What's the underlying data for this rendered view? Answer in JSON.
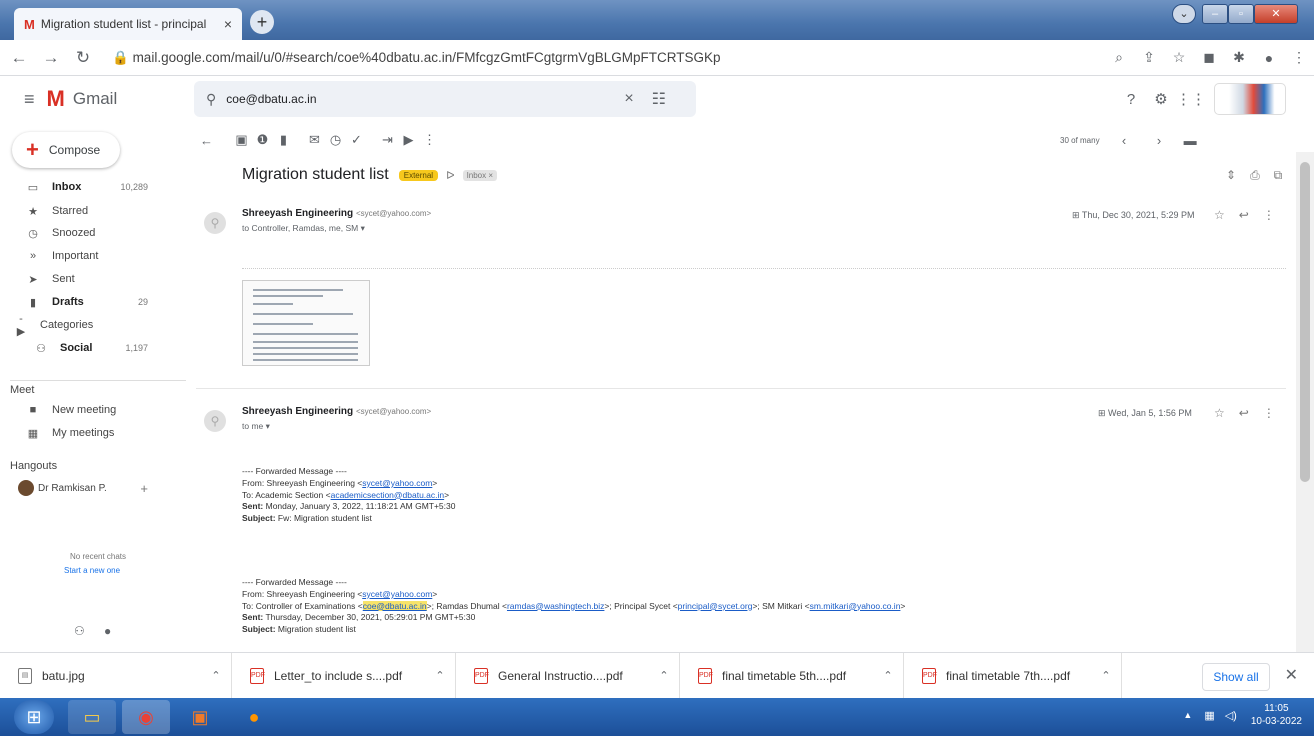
{
  "browser": {
    "tab_title": "Migration student list - principal",
    "tab_close": "×",
    "new_tab": "+",
    "url": "mail.google.com/mail/u/0/#search/coe%40dbatu.ac.in/FMfcgzGmtFCgtgrmVgBLGMpFTCRTSGKp"
  },
  "gmail": {
    "app_name": "Gmail",
    "search_value": "coe@dbatu.ac.in",
    "compose": "Compose",
    "nav": [
      {
        "icon": "inbox-icon",
        "label": "Inbox",
        "count": "10,289",
        "bold": true
      },
      {
        "icon": "star-icon",
        "label": "Starred",
        "count": ""
      },
      {
        "icon": "clock-icon",
        "label": "Snoozed",
        "count": ""
      },
      {
        "icon": "important-icon",
        "label": "Important",
        "count": ""
      },
      {
        "icon": "send-icon",
        "label": "Sent",
        "count": ""
      },
      {
        "icon": "draft-icon",
        "label": "Drafts",
        "count": "29",
        "bold": true
      },
      {
        "icon": "label-icon",
        "label": "Categories",
        "count": ""
      },
      {
        "icon": "people-icon",
        "label": "Social",
        "count": "1,197",
        "bold": true
      }
    ],
    "meet_title": "Meet",
    "meet_items": [
      "New meeting",
      "My meetings"
    ],
    "hangouts_title": "Hangouts",
    "hangouts_user": "Dr Ramkisan P.",
    "no_chats": "No recent chats",
    "start_new": "Start a new one",
    "pagination": "30 of many",
    "subject": "Migration student list",
    "badge_external": "External",
    "chip_inbox": "Inbox ×"
  },
  "messages": [
    {
      "sender": "Shreeyash Engineering",
      "email": "<sycet@yahoo.com>",
      "to": "to Controller, Ramdas, me, SM ▾",
      "date": "Thu, Dec 30, 2021, 5:29 PM"
    },
    {
      "sender": "Shreeyash Engineering",
      "email": "<sycet@yahoo.com>",
      "to": "to me ▾",
      "date": "Wed, Jan 5, 1:56 PM"
    }
  ],
  "forward1": {
    "header": "---- Forwarded Message ----",
    "from_label": "From: Shreeyash Engineering <",
    "from_email": "sycet@yahoo.com",
    "to_label": "To: Academic Section <",
    "to_email": "academicsection@dbatu.ac.in",
    "sent_label": "Sent:",
    "sent_value": " Monday, January 3, 2022, 11:18:21 AM GMT+5:30",
    "subject_label": "Subject:",
    "subject_value": " Fw: Migration student list"
  },
  "forward2": {
    "header": "---- Forwarded Message ----",
    "from_label": "From: Shreeyash Engineering <",
    "from_email": "sycet@yahoo.com",
    "to_prefix": "To: Controller of Examinations <",
    "to_email1": "coe@dbatu.ac.in",
    "to_mid1": ">; Ramdas Dhumal <",
    "to_email2": "ramdas@washingtech.biz",
    "to_mid2": ">; Principal Sycet <",
    "to_email3": "principal@sycet.org",
    "to_mid3": ">; SM Mitkari <",
    "to_email4": "sm.mitkari@yahoo.co.in",
    "to_end": ">",
    "sent_label": "Sent:",
    "sent_value": " Thursday, December 30, 2021, 05:29:01 PM GMT+5:30",
    "subject_label": "Subject:",
    "subject_value": " Migration student list"
  },
  "downloads": [
    {
      "name": "batu.jpg",
      "type": "img"
    },
    {
      "name": "Letter_to include s....pdf",
      "type": "pdf"
    },
    {
      "name": "General Instructio....pdf",
      "type": "pdf"
    },
    {
      "name": "final timetable 5th....pdf",
      "type": "pdf"
    },
    {
      "name": "final timetable 7th....pdf",
      "type": "pdf"
    }
  ],
  "show_all": "Show all",
  "clock": {
    "time": "11:05",
    "date": "10-03-2022"
  },
  "colors": {
    "gmail_red": "#d93025",
    "external_badge": "#f7c81d",
    "taskbar": "#1c4f98"
  }
}
